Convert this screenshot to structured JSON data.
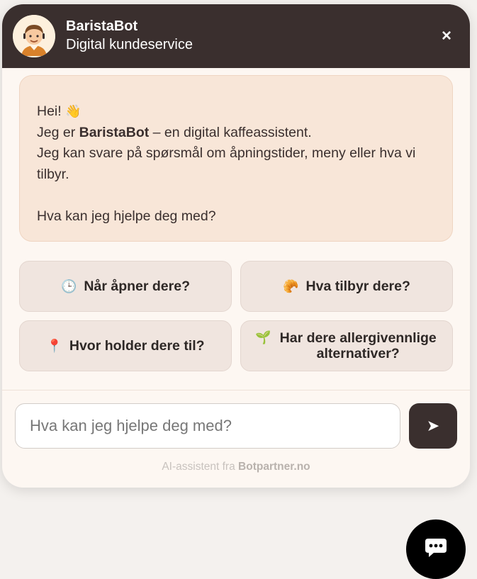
{
  "header": {
    "bot_name": "BaristaBot",
    "subtitle": "Digital kundeservice",
    "close_label": "×",
    "avatar_icon": "barista-avatar-icon"
  },
  "message": {
    "greeting": "Hei!",
    "greeting_emoji": "👋",
    "intro_prefix": "Jeg er ",
    "intro_name": "BaristaBot",
    "intro_suffix": " – en digital kaffeassistent.",
    "line3": "Jeg kan svare på spørsmål om åpningstider, meny eller hva vi tilbyr.",
    "question": "Hva kan jeg hjelpe deg med?"
  },
  "quick_replies": [
    {
      "icon": "🕒",
      "icon_name": "clock-icon",
      "label": "Når åpner dere?"
    },
    {
      "icon": "🥐",
      "icon_name": "croissant-icon",
      "label": "Hva tilbyr dere?"
    },
    {
      "icon": "📍",
      "icon_name": "pin-icon",
      "label": "Hvor holder dere til?"
    },
    {
      "icon": "🌱",
      "icon_name": "seedling-icon",
      "label": "Har dere allergivennlige alternativer?"
    }
  ],
  "input": {
    "placeholder": "Hva kan jeg hjelpe deg med?",
    "value": ""
  },
  "send": {
    "icon": "➤",
    "icon_name": "send-icon"
  },
  "footer": {
    "prefix": "AI-assistent fra ",
    "brand": "Botpartner.no"
  },
  "fab": {
    "icon_name": "chat-bubble-icon"
  },
  "colors": {
    "header_bg": "#3a2f2e",
    "message_bg": "#f8e6d8",
    "quick_reply_bg": "#f0e5df",
    "widget_bg": "#fdf7f2",
    "fab_bg": "#000000"
  }
}
